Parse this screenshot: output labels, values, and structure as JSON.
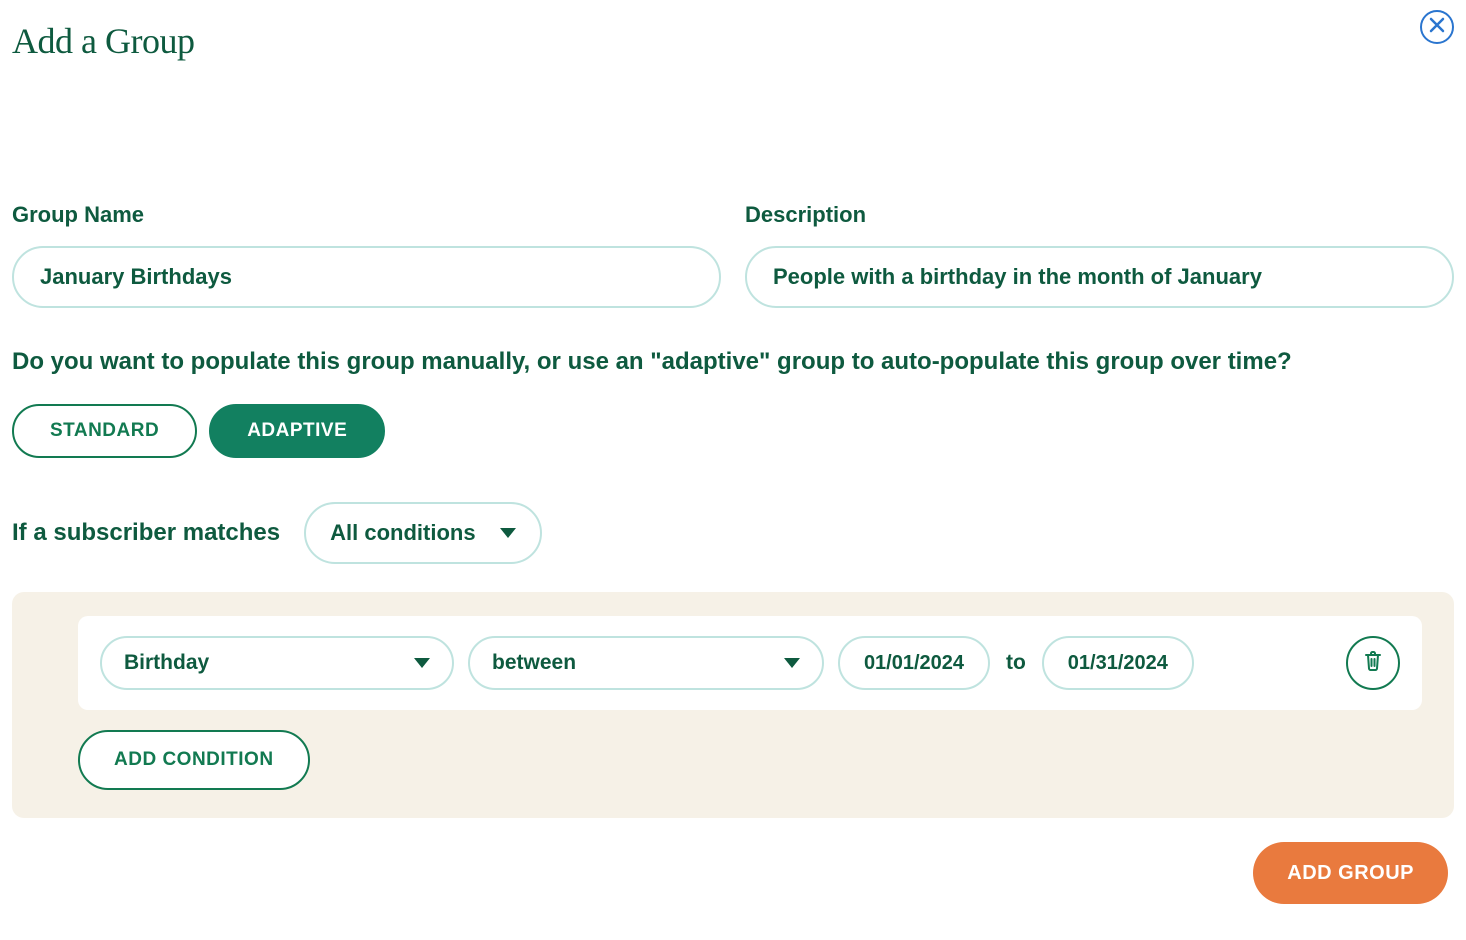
{
  "header": {
    "title": "Add a Group"
  },
  "form": {
    "group_name": {
      "label": "Group Name",
      "value": "January Birthdays"
    },
    "description": {
      "label": "Description",
      "value": "People with a birthday in the month of January"
    },
    "populate_question": "Do you want to populate this group manually, or use an \"adaptive\" group to auto-populate this group over time?",
    "mode": {
      "standard_label": "STANDARD",
      "adaptive_label": "ADAPTIVE",
      "selected": "adaptive"
    },
    "match": {
      "prefix": "If a subscriber matches",
      "selected": "All conditions"
    },
    "conditions": [
      {
        "field": "Birthday",
        "operator": "between",
        "from": "01/01/2024",
        "to_label": "to",
        "to": "01/31/2024"
      }
    ],
    "add_condition_label": "ADD CONDITION"
  },
  "footer": {
    "submit_label": "ADD GROUP"
  }
}
